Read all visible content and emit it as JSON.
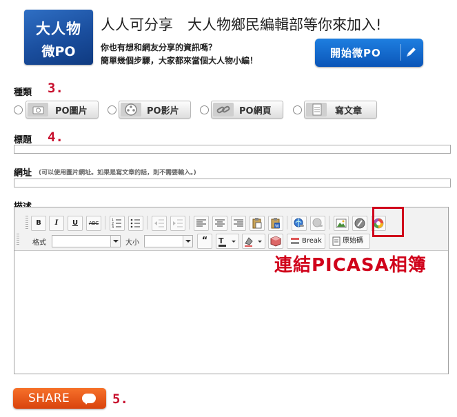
{
  "header": {
    "logo_line1": "大人物",
    "logo_line2": "微PO",
    "headline": "人人可分享　大人物鄉民編輯部等你來加入!",
    "sub1": "你也有想和網友分享的資訊嗎？",
    "sub2": "簡單幾個步驟，大家都來當個大人物小編！",
    "start_button": "開始微PO"
  },
  "type_section": {
    "label": "種類",
    "step": "3.",
    "options": [
      "PO圖片",
      "PO影片",
      "PO網頁",
      "寫文章"
    ]
  },
  "title_section": {
    "label": "標題",
    "step": "4."
  },
  "url_section": {
    "label": "網址",
    "hint": "(可以使用圖片網址。如果是寫文章的話，則不需要輸入。)"
  },
  "desc_section": {
    "label": "描述"
  },
  "editor": {
    "format_label": "格式",
    "size_label": "大小",
    "break_label": "Break",
    "source_label": "原始碼",
    "quote_label": "“"
  },
  "annotation": "連結PICASA相簿",
  "share": {
    "label": "SHARE",
    "step": "5."
  },
  "colors": {
    "accent_red": "#d0021b",
    "brand_blue": "#0b55b8",
    "share_orange": "#e85a1b"
  }
}
